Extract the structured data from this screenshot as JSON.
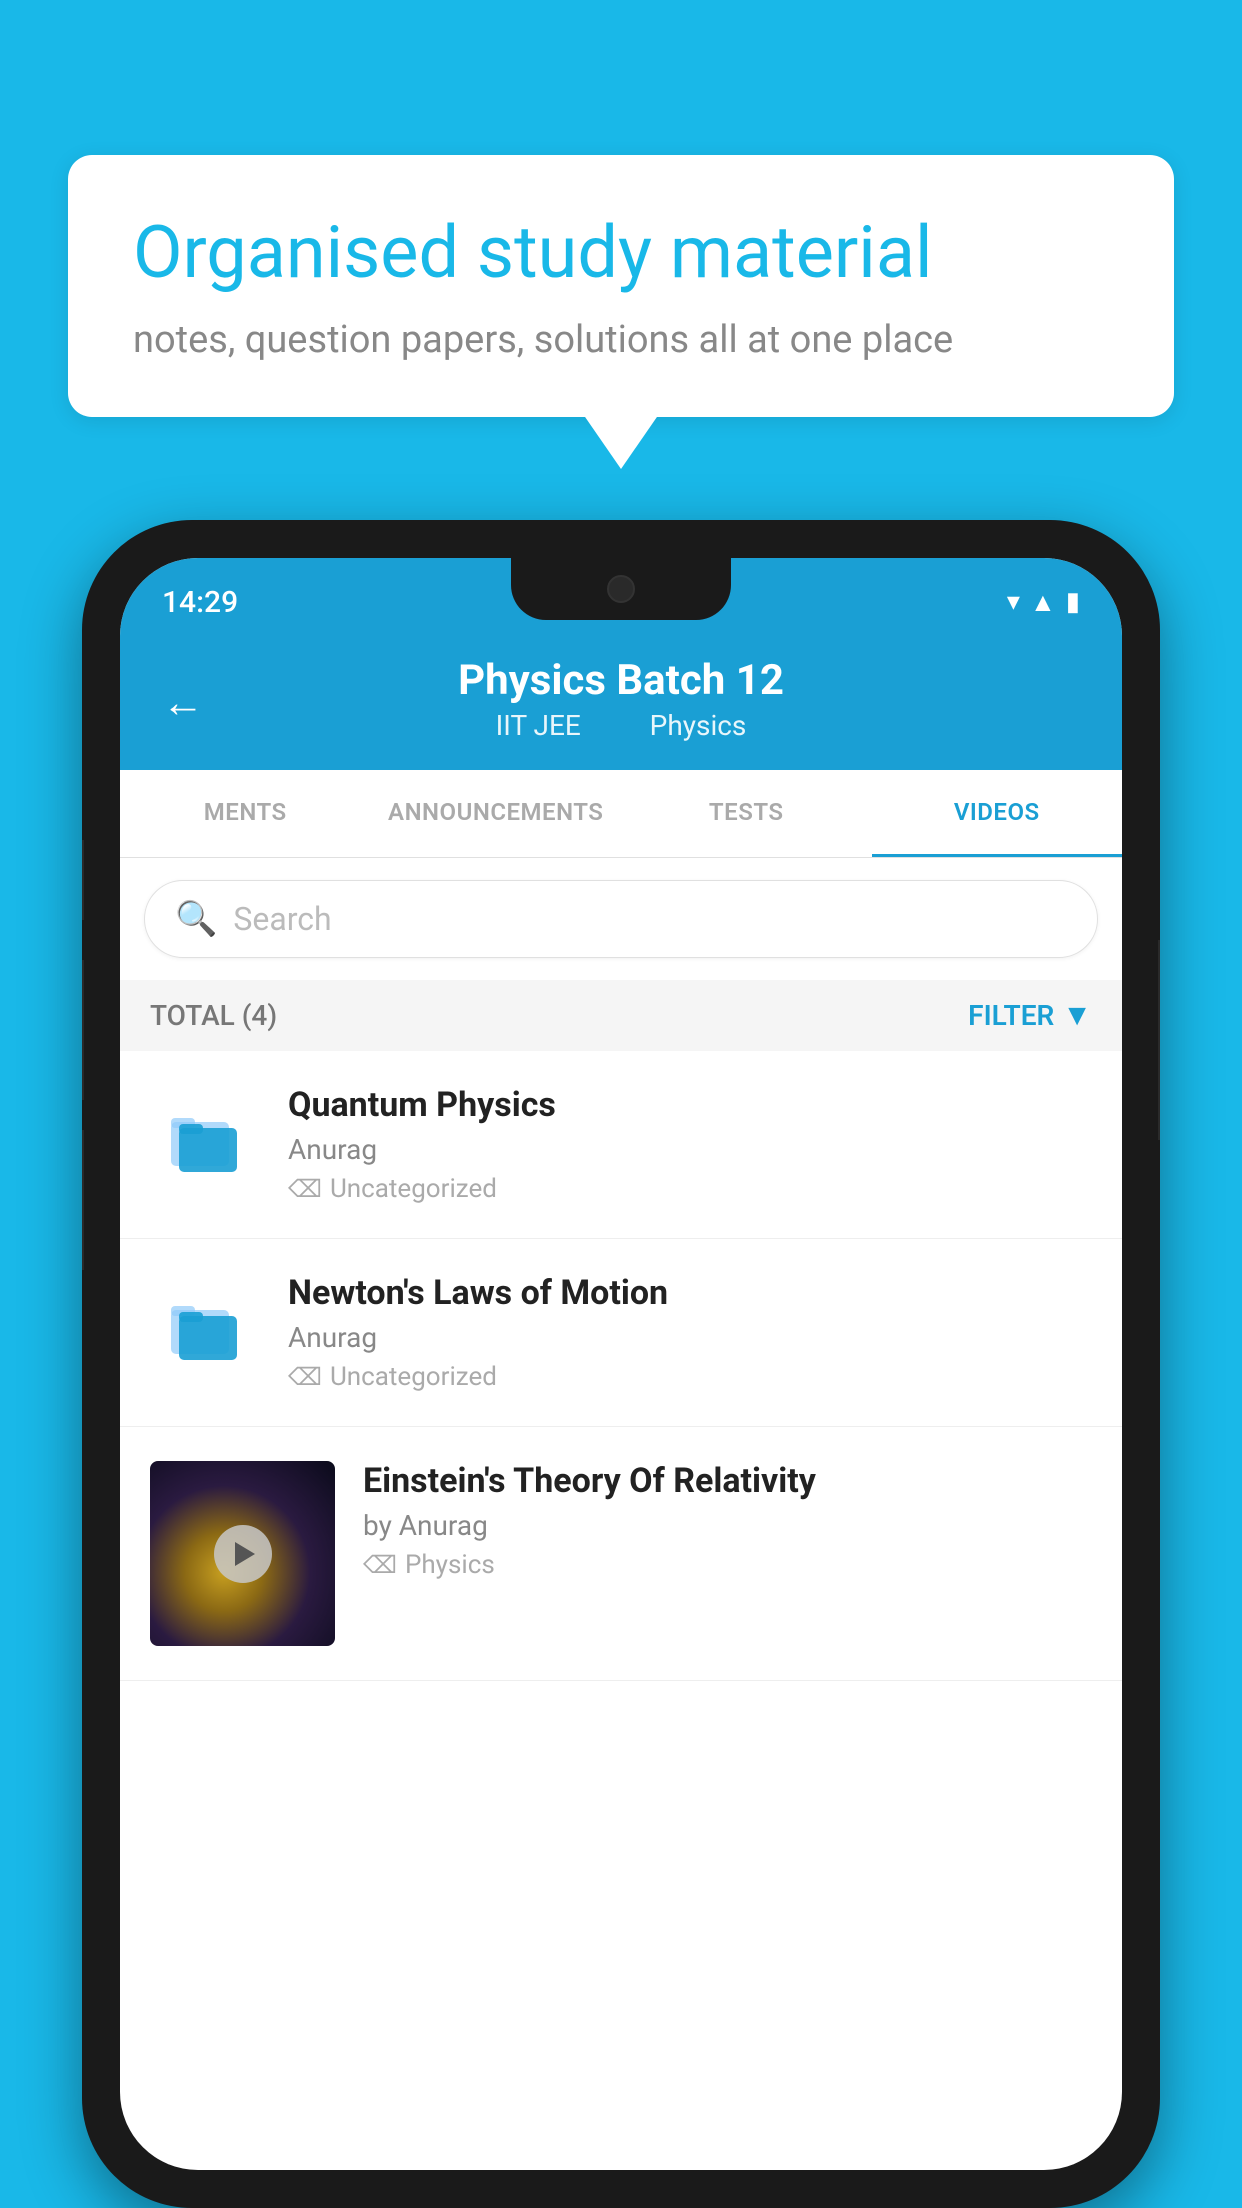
{
  "background_color": "#19b8e8",
  "speech_bubble": {
    "title": "Organised study material",
    "subtitle": "notes, question papers, solutions all at one place"
  },
  "status_bar": {
    "time": "14:29"
  },
  "app_header": {
    "back_label": "←",
    "title": "Physics Batch 12",
    "subtitle_part1": "IIT JEE",
    "subtitle_part2": "Physics"
  },
  "tabs": [
    {
      "label": "MENTS",
      "active": false
    },
    {
      "label": "ANNOUNCEMENTS",
      "active": false
    },
    {
      "label": "TESTS",
      "active": false
    },
    {
      "label": "VIDEOS",
      "active": true
    }
  ],
  "search": {
    "placeholder": "Search"
  },
  "filter_bar": {
    "total_label": "TOTAL (4)",
    "filter_label": "FILTER"
  },
  "videos": [
    {
      "title": "Quantum Physics",
      "author": "Anurag",
      "tag": "Uncategorized",
      "has_thumbnail": false
    },
    {
      "title": "Newton's Laws of Motion",
      "author": "Anurag",
      "tag": "Uncategorized",
      "has_thumbnail": false
    },
    {
      "title": "Einstein's Theory Of Relativity",
      "author": "by Anurag",
      "tag": "Physics",
      "has_thumbnail": true
    }
  ],
  "colors": {
    "accent": "#1a9fd4",
    "bg": "#19b8e8"
  }
}
